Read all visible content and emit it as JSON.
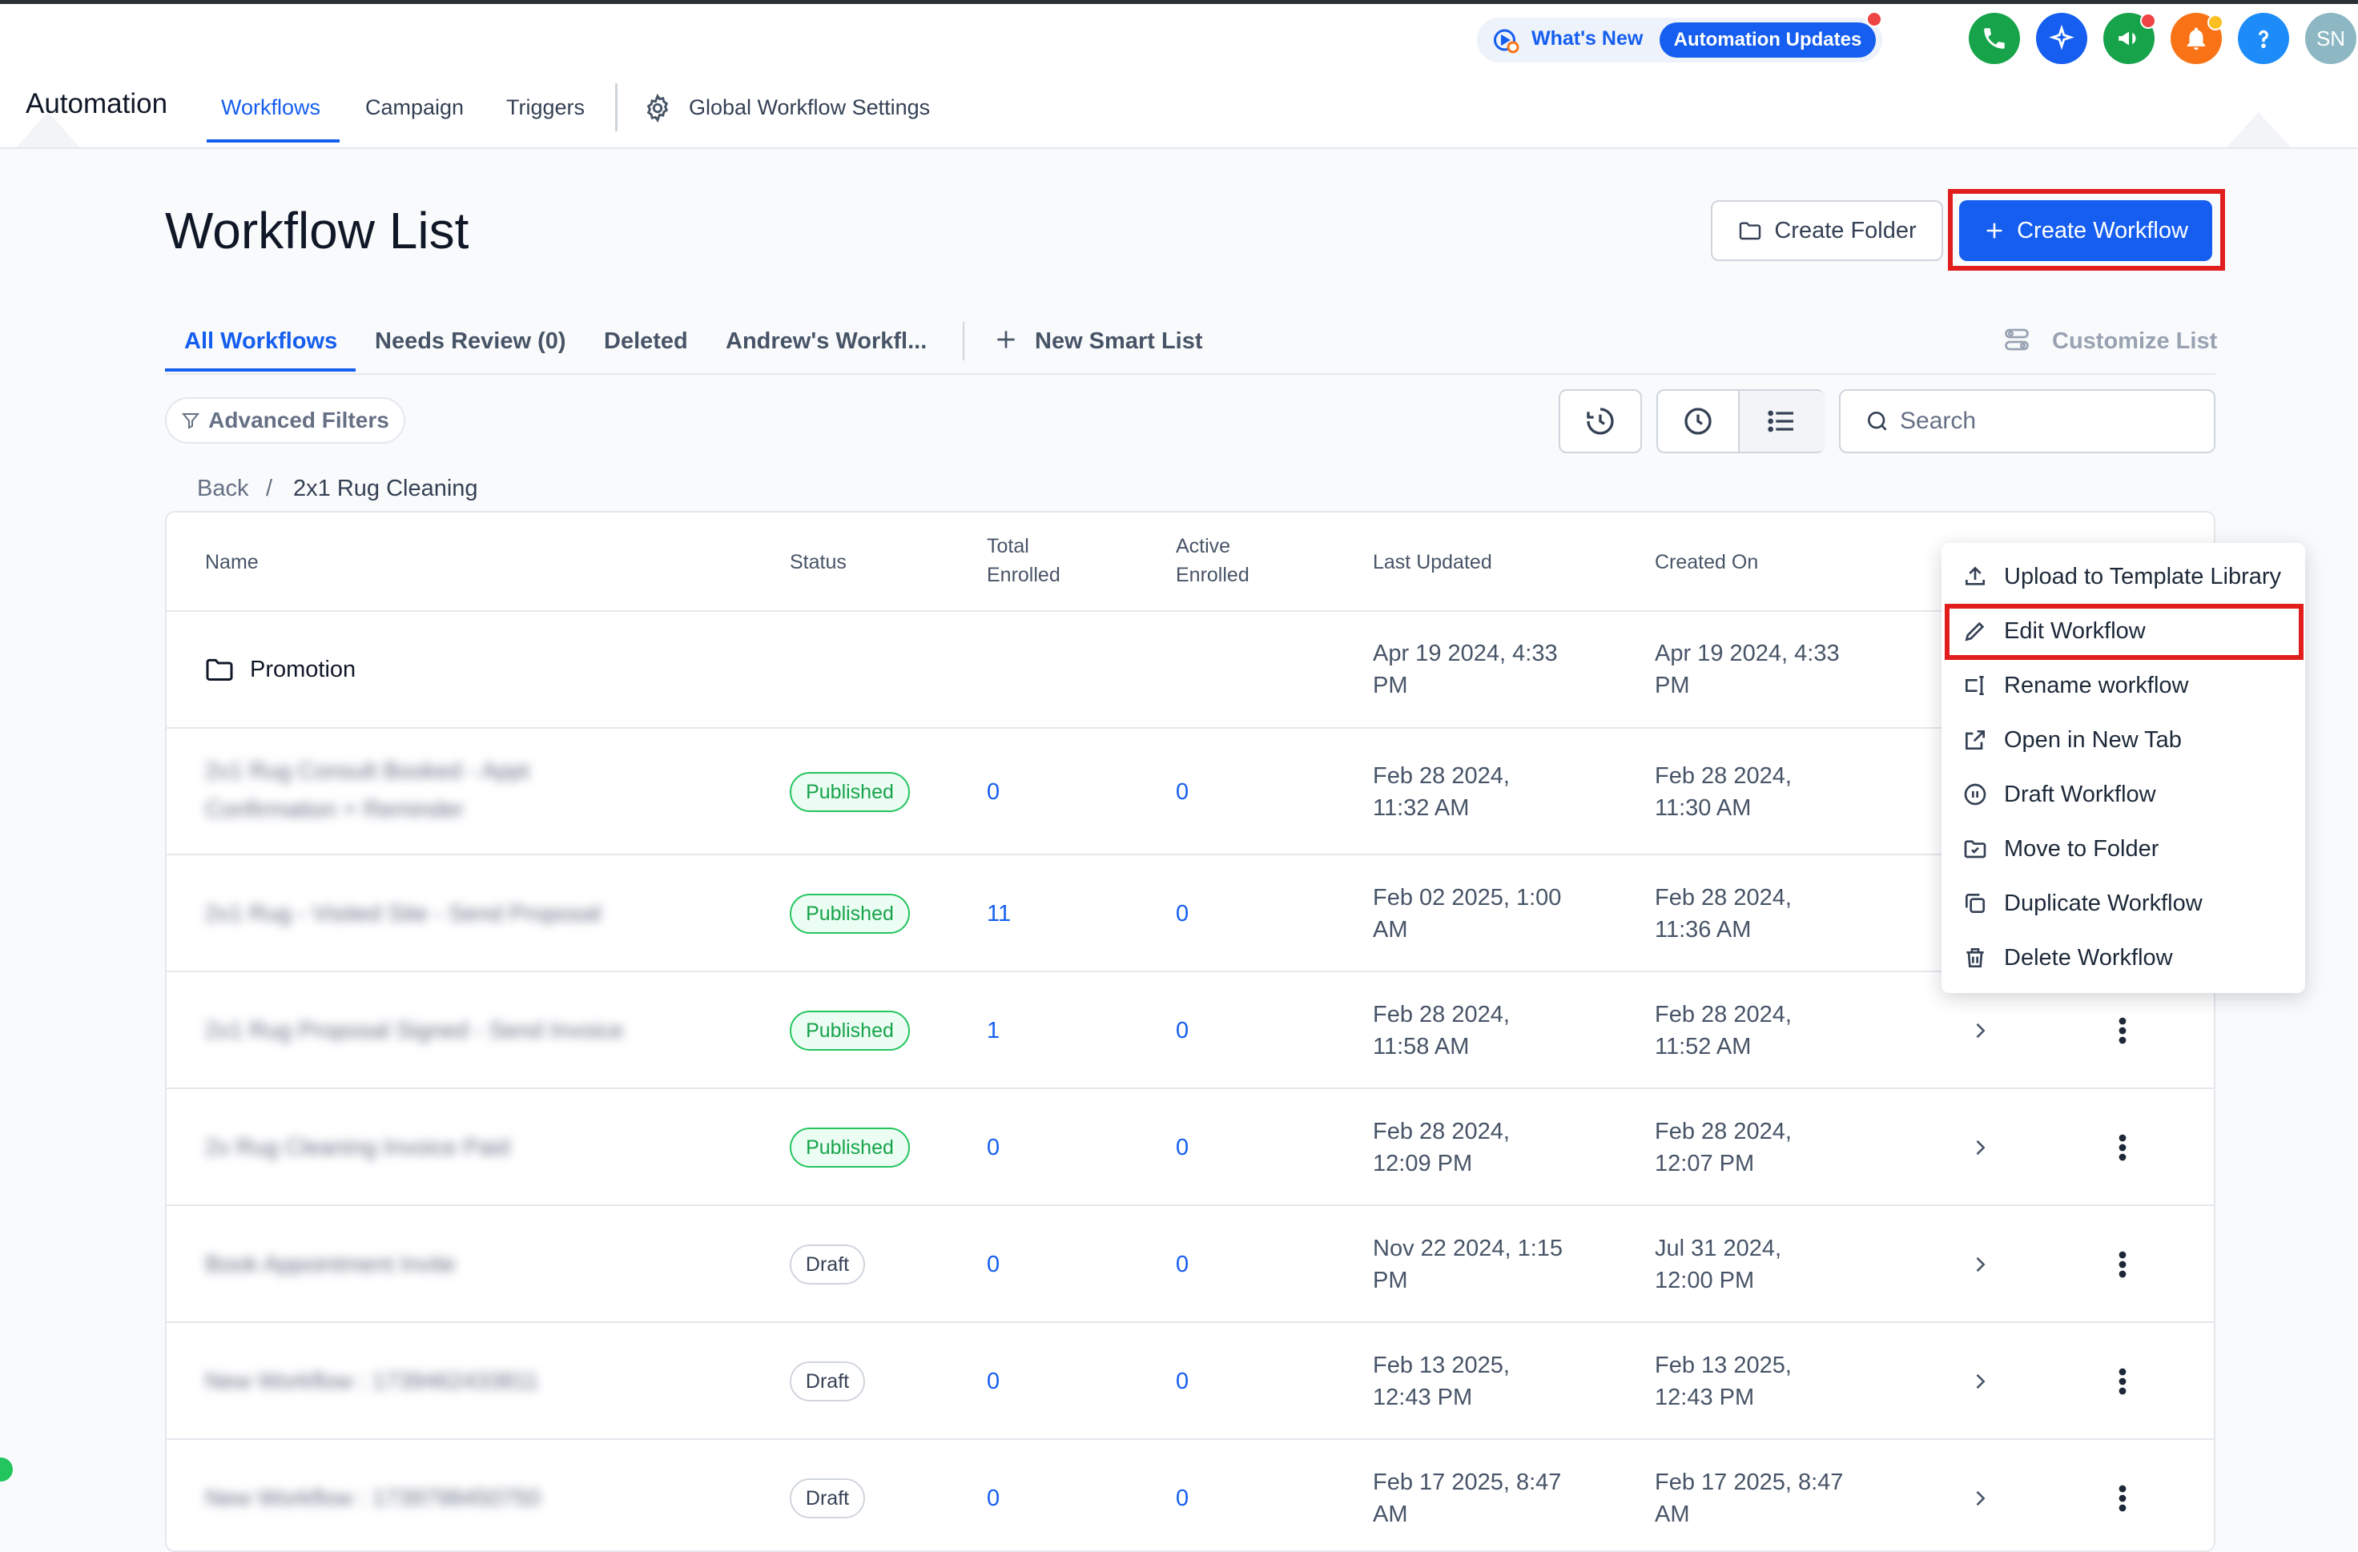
{
  "header": {
    "whats_new": "What's New",
    "automation_updates": "Automation Updates",
    "avatar_initials": "SN",
    "app_title": "Automation",
    "nav": [
      "Workflows",
      "Campaign",
      "Triggers"
    ],
    "global_settings": "Global Workflow Settings"
  },
  "page": {
    "title": "Workflow List",
    "create_folder": "Create Folder",
    "create_workflow": "Create Workflow",
    "tabs": [
      "All Workflows",
      "Needs Review (0)",
      "Deleted",
      "Andrew's Workfl..."
    ],
    "new_smart_list": "New Smart List",
    "customize_list": "Customize List",
    "advanced_filters": "Advanced Filters",
    "search_placeholder": "Search",
    "breadcrumb_back": "Back",
    "breadcrumb_sep": "/",
    "breadcrumb_current": "2x1 Rug Cleaning"
  },
  "table": {
    "headers": {
      "name": "Name",
      "status": "Status",
      "total_1": "Total",
      "total_2": "Enrolled",
      "active_1": "Active",
      "active_2": "Enrolled",
      "last_updated": "Last Updated",
      "created_on": "Created On"
    },
    "folder": {
      "name": "Promotion",
      "last_1": "Apr 19 2024, 4:33",
      "last_2": "PM",
      "created_1": "Apr 19 2024, 4:33",
      "created_2": "PM"
    },
    "rows": [
      {
        "name_1": "2x1 Rug Consult Booked - Appt",
        "name_2": "Confirmation + Reminder",
        "status": "Published",
        "total": "0",
        "active": "0",
        "last_1": "Feb 28 2024,",
        "last_2": "11:32 AM",
        "created_1": "Feb 28 2024,",
        "created_2": "11:30 AM"
      },
      {
        "name_1": "2x1 Rug - Visited Site - Send Proposal",
        "name_2": "",
        "status": "Published",
        "total": "11",
        "active": "0",
        "last_1": "Feb 02 2025, 1:00",
        "last_2": "AM",
        "created_1": "Feb 28 2024,",
        "created_2": "11:36 AM"
      },
      {
        "name_1": "2x1 Rug Proposal Signed - Send Invoice",
        "name_2": "",
        "status": "Published",
        "total": "1",
        "active": "0",
        "last_1": "Feb 28 2024,",
        "last_2": "11:58 AM",
        "created_1": "Feb 28 2024,",
        "created_2": "11:52 AM"
      },
      {
        "name_1": "2x Rug Cleaning Invoice Paid",
        "name_2": "",
        "status": "Published",
        "total": "0",
        "active": "0",
        "last_1": "Feb 28 2024,",
        "last_2": "12:09 PM",
        "created_1": "Feb 28 2024,",
        "created_2": "12:07 PM"
      },
      {
        "name_1": "Book Appointment Invite",
        "name_2": "",
        "status": "Draft",
        "total": "0",
        "active": "0",
        "last_1": "Nov 22 2024, 1:15",
        "last_2": "PM",
        "created_1": "Jul 31 2024,",
        "created_2": "12:00 PM"
      },
      {
        "name_1": "New Workflow : 1739462433811",
        "name_2": "",
        "status": "Draft",
        "total": "0",
        "active": "0",
        "last_1": "Feb 13 2025,",
        "last_2": "12:43 PM",
        "created_1": "Feb 13 2025,",
        "created_2": "12:43 PM"
      },
      {
        "name_1": "New Workflow : 1739798450750",
        "name_2": "",
        "status": "Draft",
        "total": "0",
        "active": "0",
        "last_1": "Feb 17 2025, 8:47",
        "last_2": "AM",
        "created_1": "Feb 17 2025, 8:47",
        "created_2": "AM"
      }
    ]
  },
  "menu": {
    "items": [
      "Upload to Template Library",
      "Edit Workflow",
      "Rename workflow",
      "Open in New Tab",
      "Draft Workflow",
      "Move to Folder",
      "Duplicate Workflow",
      "Delete Workflow"
    ]
  },
  "colors": {
    "accent": "#155eef",
    "highlight": "#e11d1d",
    "published": "#16a34a"
  }
}
